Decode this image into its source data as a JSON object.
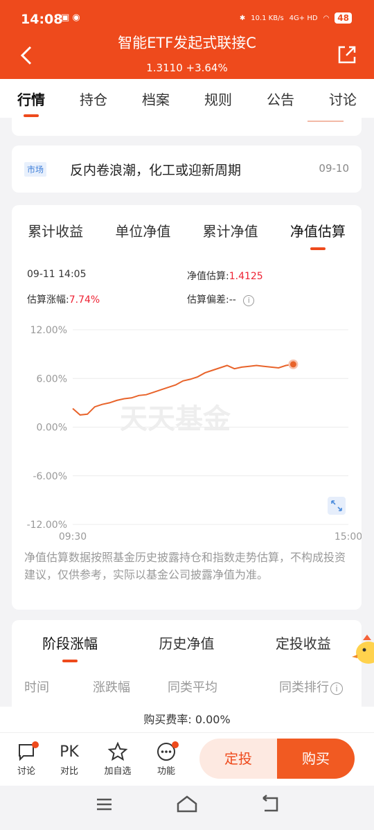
{
  "status": {
    "time": "14:08",
    "speed": "10.1 KB/s",
    "network": "4G+ HD",
    "battery": "48"
  },
  "header": {
    "title": "智能ETF发起式联接C",
    "nav": "1.3110 +3.64%"
  },
  "tabs": [
    "行情",
    "持仓",
    "档案",
    "规则",
    "公告",
    "讨论"
  ],
  "news": {
    "tag": "市场",
    "title": "反内卷浪潮，化工或迎新周期",
    "date": "09-10"
  },
  "chart_tabs": [
    "累计收益",
    "单位净值",
    "累计净值",
    "净值估算"
  ],
  "estimate": {
    "datetime": "09-11 14:05",
    "nav_label": "净值估算:",
    "nav_value": "1.4125",
    "change_label": "估算涨幅:",
    "change_value": "7.74%",
    "deviation_label": "估算偏差:",
    "deviation_value": "--"
  },
  "watermark": "天天基金",
  "chart_data": {
    "type": "line",
    "y_ticks": [
      "12.00%",
      "6.00%",
      "0.00%",
      "-6.00%",
      "-12.00%"
    ],
    "ylim": [
      -12,
      12
    ],
    "x_ticks": [
      "09:30",
      "15:00"
    ],
    "series": [
      {
        "color": "#e8632a",
        "values": [
          2.3,
          1.5,
          1.6,
          2.5,
          2.8,
          3.0,
          3.3,
          3.5,
          3.6,
          3.9,
          4.0,
          4.3,
          4.6,
          4.9,
          5.2,
          5.7,
          5.9,
          6.2,
          6.7,
          7.0,
          7.3,
          7.6,
          7.2,
          7.4,
          7.5,
          7.6,
          7.5,
          7.4,
          7.3,
          7.6,
          7.74
        ]
      }
    ],
    "accent_color": "#ee4a1c"
  },
  "note": "净值估算数据按照基金历史披露持仓和指数走势估算，不构成投资建议，仅供参考，实际以基金公司披露净值为准。",
  "stage_tabs": [
    "阶段涨幅",
    "历史净值",
    "定投收益"
  ],
  "stage_headers": [
    "时间",
    "涨跌幅",
    "同类平均",
    "同类排行"
  ],
  "fee": "购买费率: 0.00%",
  "bottom": {
    "items": [
      "讨论",
      "对比",
      "加自选",
      "功能"
    ],
    "pk": "PK",
    "dingtou": "定投",
    "buy": "购买"
  }
}
